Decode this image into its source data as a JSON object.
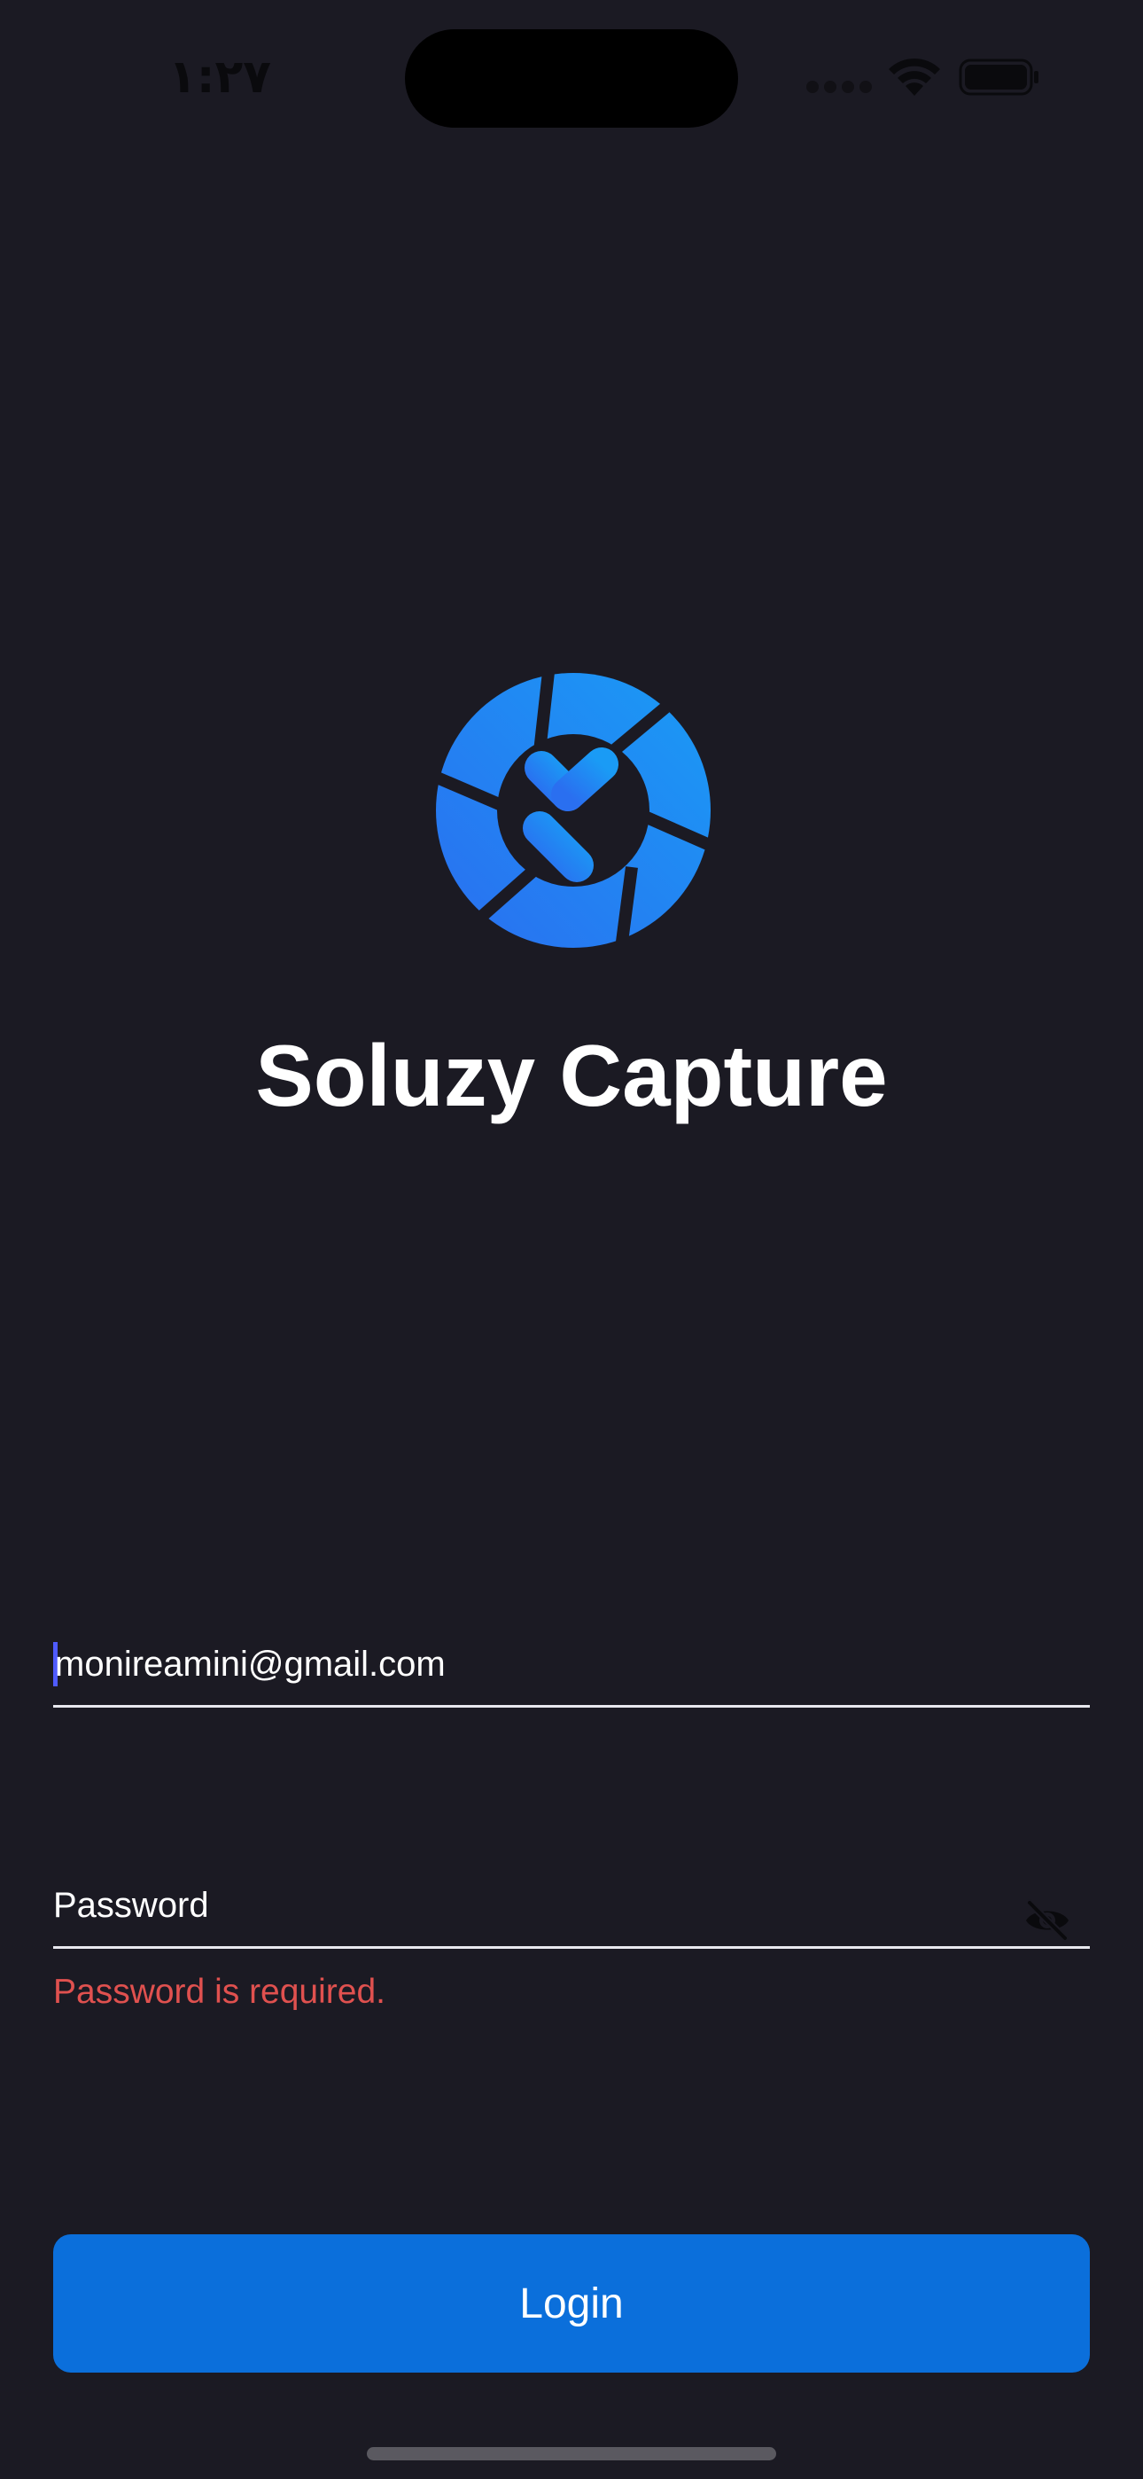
{
  "status_bar": {
    "time": "١:٢٧"
  },
  "app": {
    "title": "Soluzy Capture",
    "logo_icon": "soluzy-aperture-logo-icon"
  },
  "form": {
    "email": {
      "value": "monireamini@gmail.com"
    },
    "password": {
      "placeholder": "Password",
      "error": "Password is required.",
      "visibility_icon": "eye-off-icon"
    },
    "login_label": "Login"
  },
  "colors": {
    "background": "#1b1a23",
    "accent": "#0b6fdb",
    "error": "#e0514f",
    "logo_gradient_start": "#2a6ff0",
    "logo_gradient_end": "#1a9bf5"
  }
}
